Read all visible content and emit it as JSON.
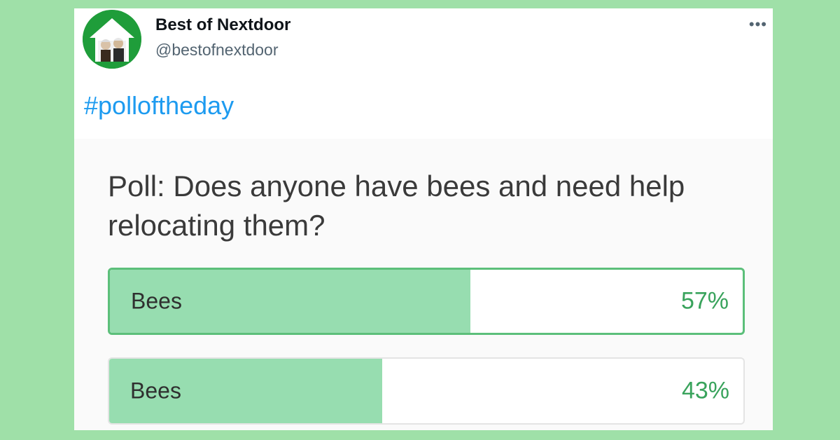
{
  "tweet": {
    "display_name": "Best of Nextdoor",
    "handle": "@bestofnextdoor",
    "more_icon": "more-horizontal-icon",
    "hashtag": "#polloftheday"
  },
  "poll": {
    "question": "Poll: Does anyone have bees and need help relocating them?",
    "options": [
      {
        "label": "Bees",
        "percent_text": "57%",
        "percent": 57,
        "selected": true
      },
      {
        "label": "Bees",
        "percent_text": "43%",
        "percent": 43,
        "selected": false
      }
    ]
  },
  "colors": {
    "page_background": "#9fe0a8",
    "link": "#1d9bf0",
    "poll_fill": "#97ddb0",
    "poll_percent": "#39a35c",
    "avatar_background": "#1f9d3a"
  }
}
